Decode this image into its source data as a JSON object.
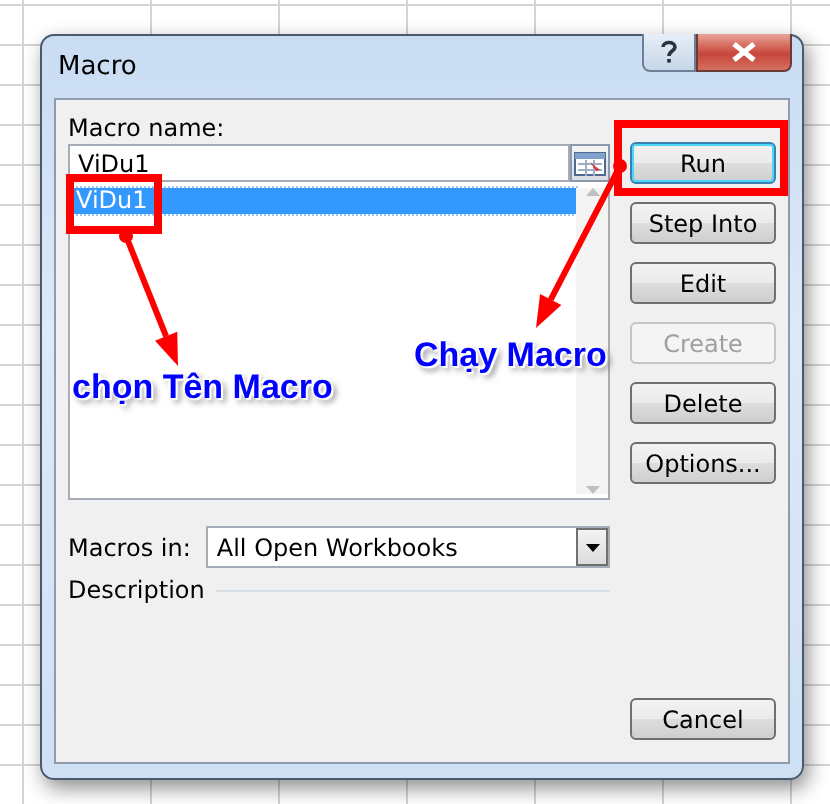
{
  "window": {
    "title": "Macro"
  },
  "macro_name": {
    "label": "Macro name:",
    "value": "ViDu1"
  },
  "macro_list": [
    {
      "name": "ViDu1",
      "selected": true
    }
  ],
  "buttons": [
    {
      "label": "Run",
      "default": true,
      "disabled": false
    },
    {
      "label": "Step Into",
      "default": false,
      "disabled": false
    },
    {
      "label": "Edit",
      "default": false,
      "disabled": false
    },
    {
      "label": "Create",
      "default": false,
      "disabled": true
    },
    {
      "label": "Delete",
      "default": false,
      "disabled": false
    },
    {
      "label": "Options...",
      "default": false,
      "disabled": false
    }
  ],
  "macros_in": {
    "label": "Macros in:",
    "value": "All Open Workbooks"
  },
  "description": {
    "label": "Description"
  },
  "cancel": {
    "label": "Cancel"
  },
  "annotations": [
    {
      "text": "chọn Tên Macro"
    },
    {
      "text": "Chạy Macro"
    }
  ]
}
